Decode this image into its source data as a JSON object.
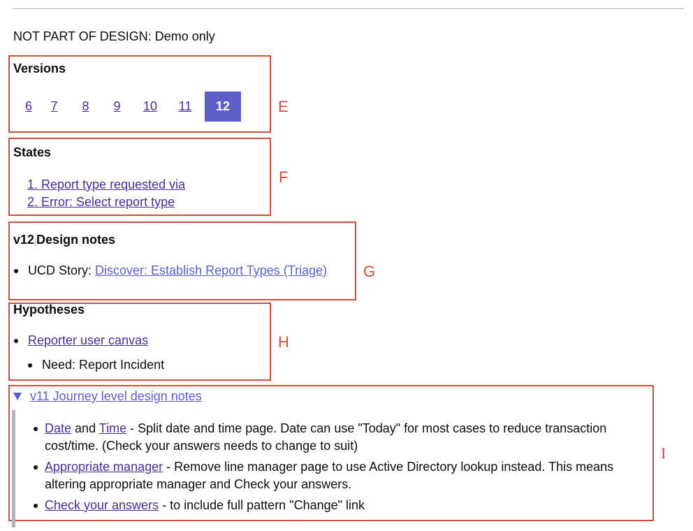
{
  "demo_note": "NOT PART OF DESIGN: Demo only",
  "versions": {
    "heading": "Versions",
    "items": [
      "6",
      "7",
      "8",
      "9",
      "10",
      "11",
      "12"
    ],
    "current": "12",
    "annotation": "E"
  },
  "states": {
    "heading": "States",
    "items": [
      "1. Report type requested via",
      "2. Error: Select report type"
    ],
    "annotation": "F"
  },
  "design_notes": {
    "version": "v12",
    "heading": "Design notes",
    "story_prefix": "UCD Story:",
    "story_link": "Discover: Establish Report Types (Triage)",
    "annotation": "G"
  },
  "hypotheses": {
    "heading": "Hypotheses",
    "canvas_link": "Reporter user canvas",
    "need": "Need: Report Incident",
    "annotation": "H"
  },
  "journey_notes": {
    "summary": "v11 Journey level design notes",
    "annotation": "I",
    "item1": {
      "link_a": "Date",
      "and": "and",
      "link_b": "Time",
      "text": "- Split date and time page. Date can use \"Today\" for most cases to reduce transaction cost/time. (Check your answers needs to change to suit)"
    },
    "item2": {
      "link": "Appropriate manager",
      "text": "- Remove line manager page to use Active Directory lookup instead. This means altering appropriate manager and Check your answers."
    },
    "item3": {
      "link": "Check your answers",
      "text": "- to include full pattern \"Change\" link"
    }
  },
  "colors": {
    "annotation_red": "#d24a3a",
    "current_version_bg": "#5b5fc7",
    "visited_link": "#4c2c92"
  }
}
